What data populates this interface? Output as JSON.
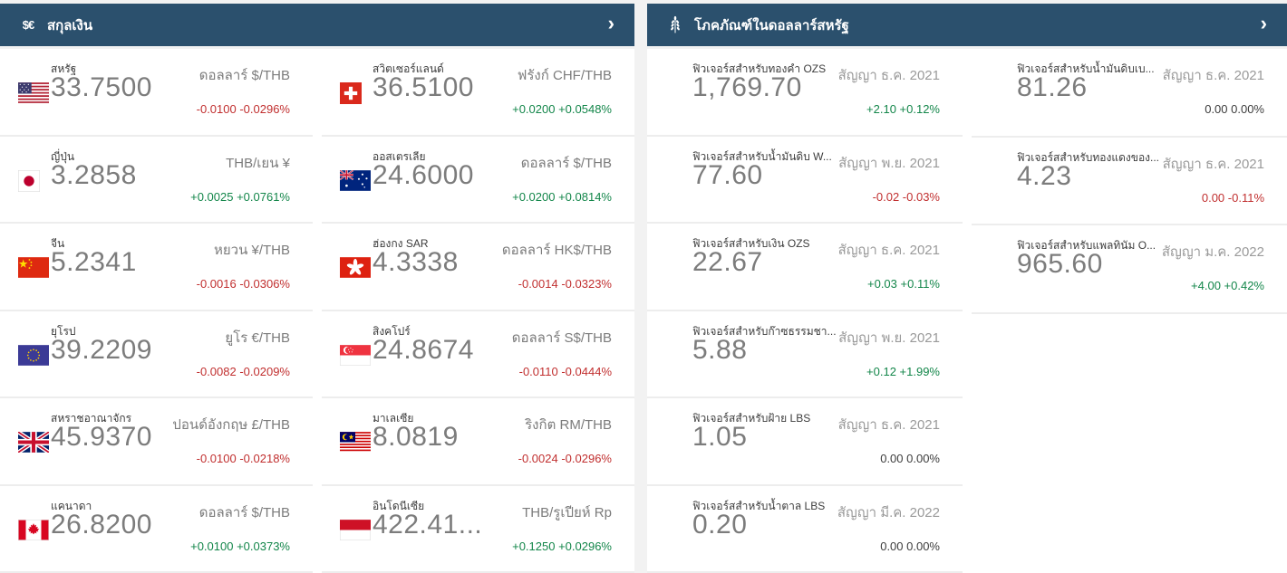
{
  "colors": {
    "header_bg": "#2b506d",
    "up": "#13864a",
    "down": "#c12f2f",
    "flat": "#3c3c3c"
  },
  "panels": {
    "currencies": {
      "title": "สกุลเงิน",
      "icon": "dollar-euro-icon",
      "icon_label": "$€",
      "chevron": "›",
      "cards": [
        {
          "flag": "us",
          "name": "สหรัฐ",
          "price": "33.7500",
          "pair": "ดอลลาร์ $/THB",
          "change": "-0.0100 -0.0296%",
          "direction": "down"
        },
        {
          "flag": "ch",
          "name": "สวิตเซอร์แลนด์",
          "price": "36.5100",
          "pair": "ฟรังก์ CHF/THB",
          "change": "+0.0200 +0.0548%",
          "direction": "up"
        },
        {
          "flag": "jp",
          "name": "ญี่ปุ่น",
          "price": "3.2858",
          "pair": "THB/เยน ¥",
          "change": "+0.0025 +0.0761%",
          "direction": "up"
        },
        {
          "flag": "au",
          "name": "ออสเตรเลีย",
          "price": "24.6000",
          "pair": "ดอลลาร์ $/THB",
          "change": "+0.0200 +0.0814%",
          "direction": "up"
        },
        {
          "flag": "cn",
          "name": "จีน",
          "price": "5.2341",
          "pair": "หยวน ¥/THB",
          "change": "-0.0016 -0.0306%",
          "direction": "down"
        },
        {
          "flag": "hk",
          "name": "ฮ่องกง SAR",
          "price": "4.3338",
          "pair": "ดอลลาร์ HK$/THB",
          "change": "-0.0014 -0.0323%",
          "direction": "down"
        },
        {
          "flag": "eu",
          "name": "ยุโรป",
          "price": "39.2209",
          "pair": "ยูโร €/THB",
          "change": "-0.0082 -0.0209%",
          "direction": "down"
        },
        {
          "flag": "sg",
          "name": "สิงคโปร์",
          "price": "24.8674",
          "pair": "ดอลลาร์ S$/THB",
          "change": "-0.0110 -0.0444%",
          "direction": "down"
        },
        {
          "flag": "gb",
          "name": "สหราชอาณาจักร",
          "price": "45.9370",
          "pair": "ปอนด์อังกฤษ £/THB",
          "change": "-0.0100 -0.0218%",
          "direction": "down"
        },
        {
          "flag": "my",
          "name": "มาเลเซีย",
          "price": "8.0819",
          "pair": "ริงกิต RM/THB",
          "change": "-0.0024 -0.0296%",
          "direction": "down"
        },
        {
          "flag": "ca",
          "name": "แคนาดา",
          "price": "26.8200",
          "pair": "ดอลลาร์ $/THB",
          "change": "+0.0100 +0.0373%",
          "direction": "up"
        },
        {
          "flag": "id",
          "name": "อินโดนีเซีย",
          "price": "422.41...",
          "pair": "THB/รูเปียห์ Rp",
          "change": "+0.1250 +0.0296%",
          "direction": "up"
        }
      ]
    },
    "commodities": {
      "title": "โภคภัณฑ์ในดอลลาร์สหรัฐ",
      "icon": "wheat-icon",
      "chevron": "›",
      "cards": [
        {
          "name": "ฟิวเจอร์สสำหรับทองคำ OZS",
          "price": "1,769.70",
          "contract": "สัญญา ธ.ค. 2021",
          "change": "+2.10 +0.12%",
          "direction": "up"
        },
        {
          "name": "ฟิวเจอร์สสำหรับน้ำมันดิบเบ...",
          "price": "81.26",
          "contract": "สัญญา ธ.ค. 2021",
          "change": "0.00 0.00%",
          "direction": "flat"
        },
        {
          "name": "ฟิวเจอร์สสำหรับน้ำมันดิบ W...",
          "price": "77.60",
          "contract": "สัญญา พ.ย. 2021",
          "change": "-0.02 -0.03%",
          "direction": "down"
        },
        {
          "name": "ฟิวเจอร์สสำหรับทองแดงของ...",
          "price": "4.23",
          "contract": "สัญญา ธ.ค. 2021",
          "change": "0.00 -0.11%",
          "direction": "down"
        },
        {
          "name": "ฟิวเจอร์สสำหรับเงิน OZS",
          "price": "22.67",
          "contract": "สัญญา ธ.ค. 2021",
          "change": "+0.03 +0.11%",
          "direction": "up"
        },
        {
          "name": "ฟิวเจอร์สสำหรับแพลทินัม O...",
          "price": "965.60",
          "contract": "สัญญา ม.ค. 2022",
          "change": "+4.00 +0.42%",
          "direction": "up"
        },
        {
          "name": "ฟิวเจอร์สสำหรับก๊าซธรรมชา...",
          "price": "5.88",
          "contract": "สัญญา พ.ย. 2021",
          "change": "+0.12 +1.99%",
          "direction": "up"
        },
        {
          "name": "ฟิวเจอร์สสำหรับฝ้าย LBS",
          "price": "1.05",
          "contract": "สัญญา ธ.ค. 2021",
          "change": "0.00 0.00%",
          "direction": "flat"
        },
        {
          "name": "ฟิวเจอร์สสำหรับน้ำตาล LBS",
          "price": "0.20",
          "contract": "สัญญา มี.ค. 2022",
          "change": "0.00 0.00%",
          "direction": "flat"
        }
      ]
    }
  }
}
